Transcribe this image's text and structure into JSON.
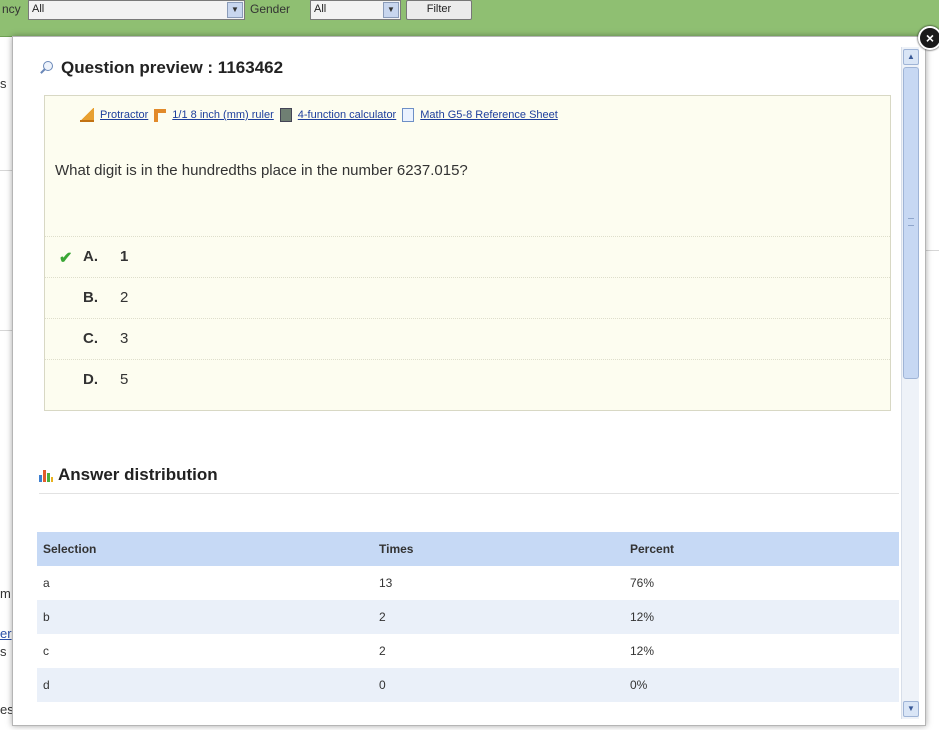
{
  "background": {
    "filter_label_1": "ncy",
    "filter_value_1": "All",
    "filter_label_2": "Gender",
    "filter_value_2": "All",
    "filter_button": "Filter",
    "edge_fragments": [
      "s",
      "m",
      "er",
      "s",
      "es"
    ]
  },
  "modal": {
    "title": "Question preview : 1163462",
    "close_label": "×",
    "tools": [
      {
        "icon": "protractor-icon",
        "label": "Protractor"
      },
      {
        "icon": "ruler-icon",
        "label": "1/1 8 inch (mm) ruler"
      },
      {
        "icon": "calculator-icon",
        "label": "4-function calculator"
      },
      {
        "icon": "document-icon",
        "label": "Math G5-8 Reference Sheet"
      }
    ],
    "question": "What digit is in the hundredths place in the number 6237.015?",
    "choices": [
      {
        "letter": "A.",
        "value": "1",
        "correct": true,
        "check": "✔"
      },
      {
        "letter": "B.",
        "value": "2",
        "correct": false
      },
      {
        "letter": "C.",
        "value": "3",
        "correct": false
      },
      {
        "letter": "D.",
        "value": "5",
        "correct": false
      }
    ],
    "distribution": {
      "title": "Answer distribution",
      "columns": [
        "Selection",
        "Times",
        "Percent"
      ],
      "rows": [
        [
          "a",
          "13",
          "76%"
        ],
        [
          "b",
          "2",
          "12%"
        ],
        [
          "c",
          "2",
          "12%"
        ],
        [
          "d",
          "0",
          "0%"
        ]
      ]
    }
  },
  "colors": {
    "filter_bar": "#8fbf72",
    "question_bg": "#fdfdf0",
    "table_header": "#c6d9f5",
    "table_alt_row": "#eaf0f9",
    "link": "#1d3e9c",
    "check": "#3aa635"
  }
}
